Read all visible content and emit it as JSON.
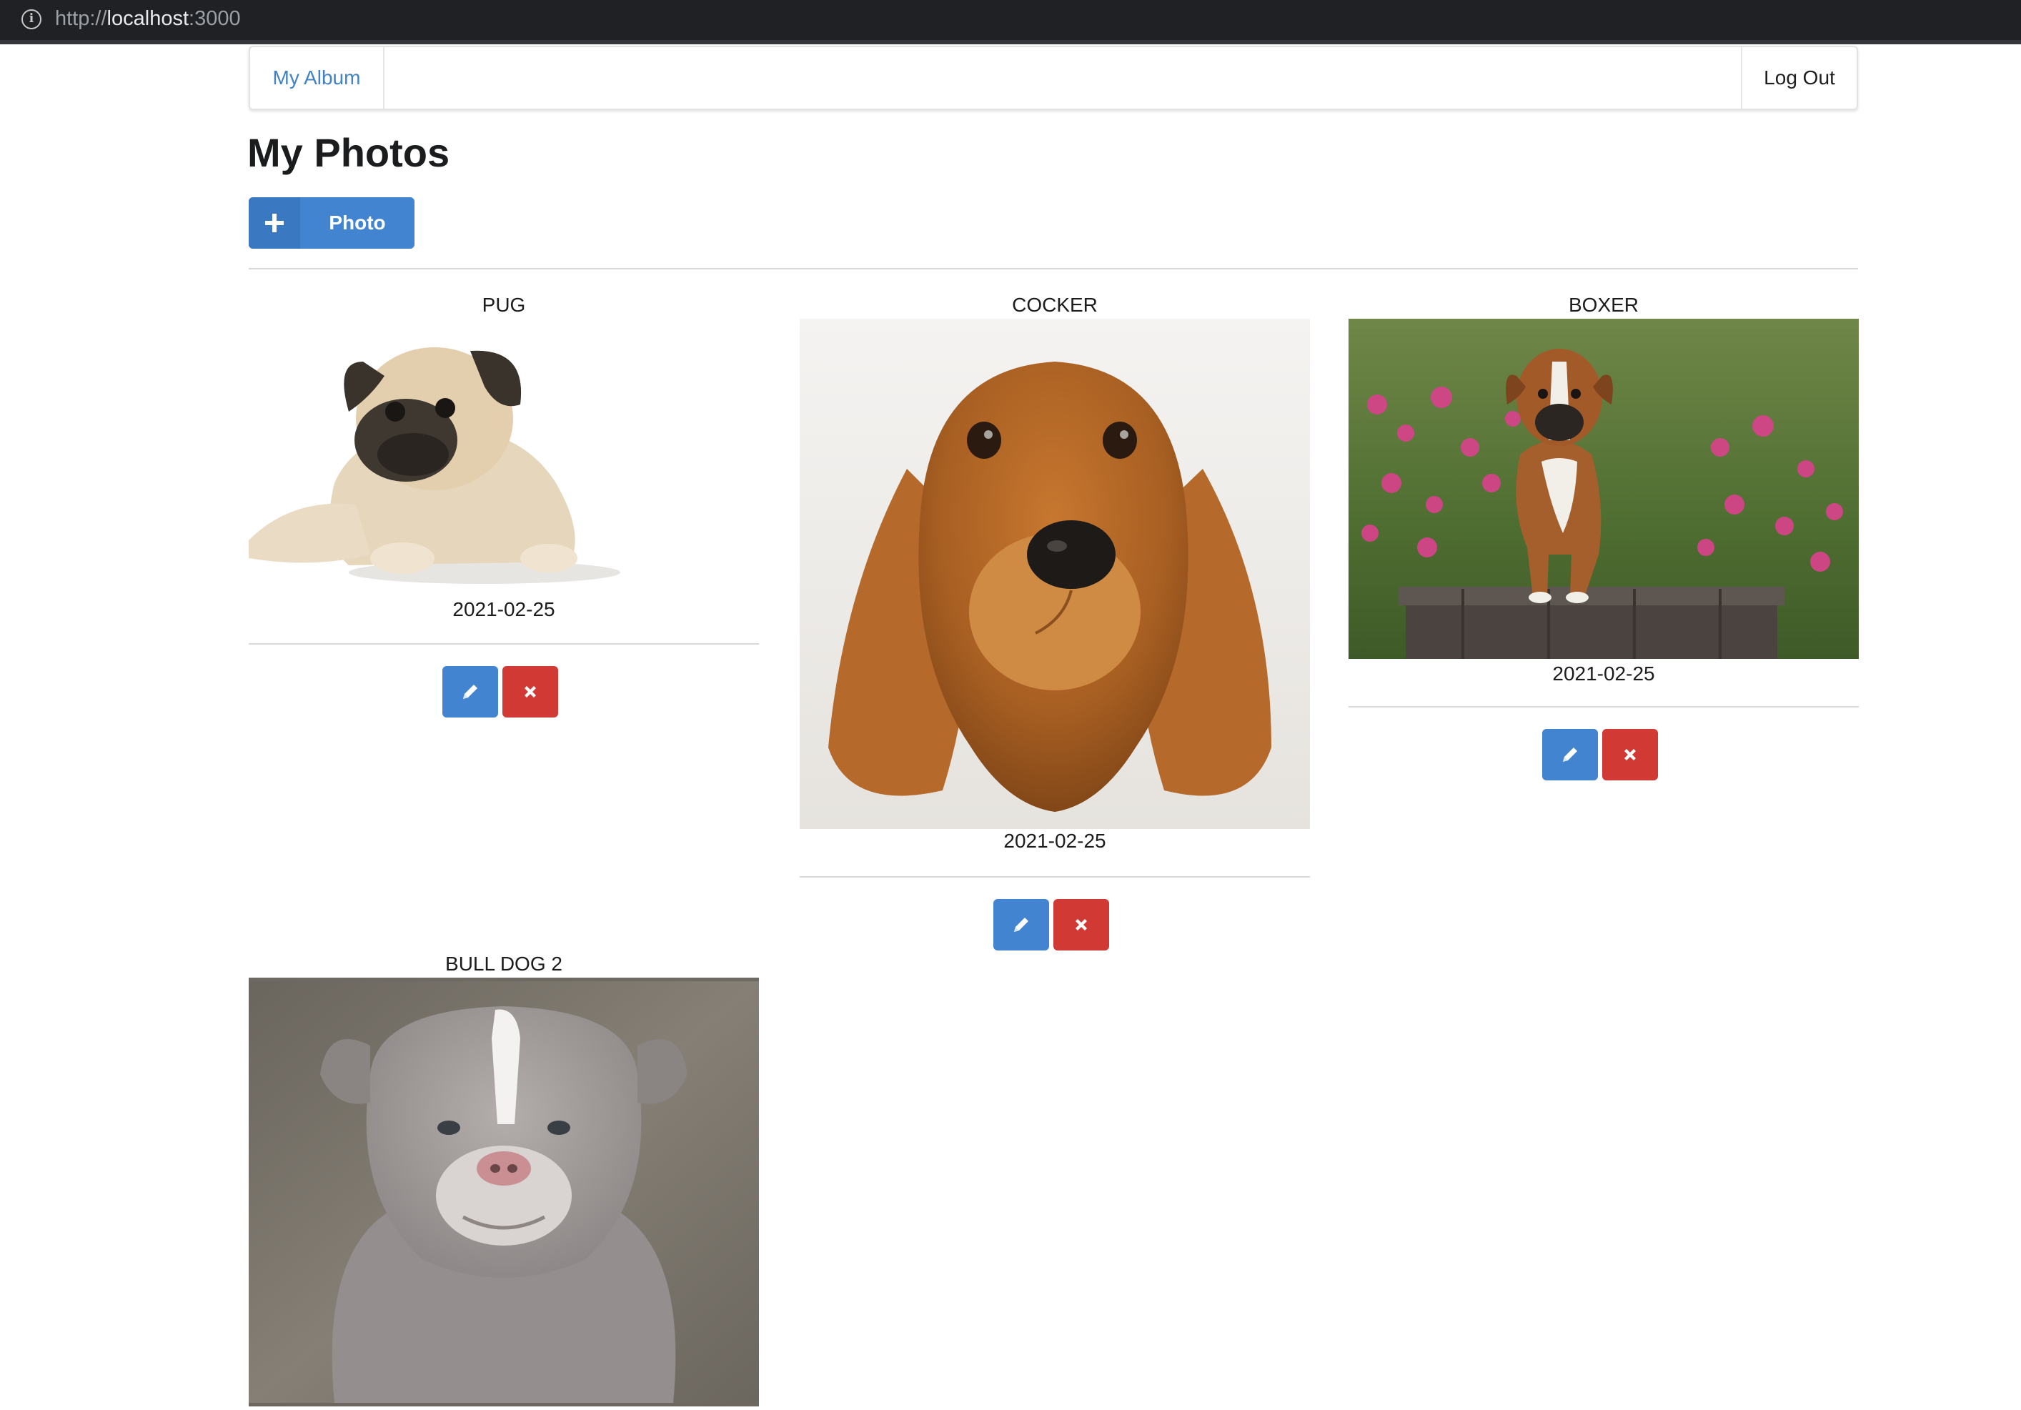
{
  "browser": {
    "url_scheme": "http://",
    "url_host": "localhost",
    "url_port": ":3000"
  },
  "navbar": {
    "brand": "My Album",
    "logout": "Log Out"
  },
  "page": {
    "title": "My Photos",
    "add_button_label": "Photo",
    "add_button_icon": "plus-icon"
  },
  "photos": [
    {
      "title": "PUG",
      "date": "2021-02-25",
      "image": "pug-photo"
    },
    {
      "title": "COCKER",
      "date": "2021-02-25",
      "image": "cocker-photo"
    },
    {
      "title": "BOXER",
      "date": "2021-02-25",
      "image": "boxer-photo"
    },
    {
      "title": "BULL DOG 2",
      "date": "",
      "image": "bulldog-photo"
    }
  ],
  "actions": {
    "edit_icon": "pencil-icon",
    "delete_icon": "close-icon"
  },
  "colors": {
    "primary": "#4384d1",
    "danger": "#d13a34",
    "link": "#4183c4"
  }
}
